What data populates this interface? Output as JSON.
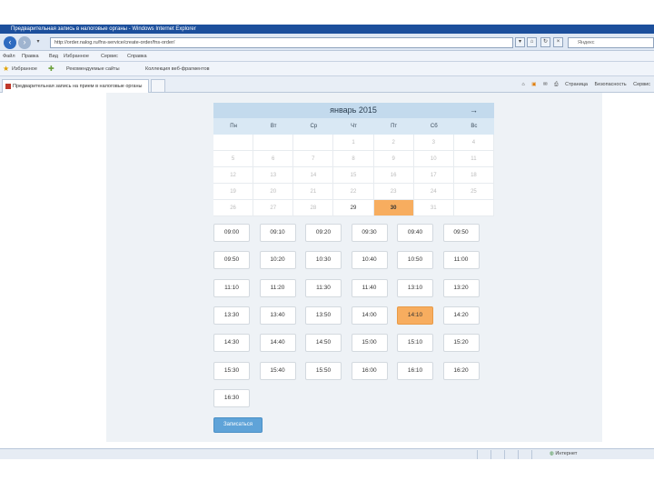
{
  "window": {
    "title": "Предварительная запись в налоговые органы - Windows Internet Explorer"
  },
  "browser": {
    "address": "http://order.nalog.ru/fns-service/create-order/fns-order/",
    "search_placeholder": "Яндекс",
    "menu": [
      "Файл",
      "Правка",
      "Вид",
      "Избранное",
      "Сервис",
      "Справка"
    ],
    "favorites_label": "Избранное",
    "favorites": [
      "Рекомендуемые сайты",
      "Коллекция веб-фрагментов"
    ],
    "tab_title": "Предварительная запись на прием в налоговые органы",
    "commands": [
      "Страница",
      "Безопасность",
      "Сервис"
    ],
    "status_zone": "Интернет"
  },
  "calendar": {
    "month_title": "январь 2015",
    "next_label": "→",
    "weekdays": [
      "Пн",
      "Вт",
      "Ср",
      "Чт",
      "Пт",
      "Сб",
      "Вс"
    ],
    "weeks": [
      [
        "",
        "",
        "",
        "1",
        "2",
        "3",
        "4"
      ],
      [
        "5",
        "6",
        "7",
        "8",
        "9",
        "10",
        "11"
      ],
      [
        "12",
        "13",
        "14",
        "15",
        "16",
        "17",
        "18"
      ],
      [
        "19",
        "20",
        "21",
        "22",
        "23",
        "24",
        "25"
      ],
      [
        "26",
        "27",
        "28",
        "29",
        "30",
        "31",
        ""
      ]
    ],
    "available_days": [
      "29"
    ],
    "selected_day": "30"
  },
  "time_slots": {
    "rows": [
      [
        "09:00",
        "09:10",
        "09:20",
        "09:30",
        "09:40",
        "09:50"
      ],
      [
        "09:50",
        "10:20",
        "10:30",
        "10:40",
        "10:50",
        "11:00"
      ],
      [
        "11:10",
        "11:20",
        "11:30",
        "11:40",
        "13:10",
        "13:20"
      ],
      [
        "13:30",
        "13:40",
        "13:50",
        "14:00",
        "14:10",
        "14:20"
      ],
      [
        "14:30",
        "14:40",
        "14:50",
        "15:00",
        "15:10",
        "15:20"
      ],
      [
        "15:30",
        "15:40",
        "15:50",
        "16:00",
        "16:10",
        "16:20"
      ],
      [
        "16:30"
      ]
    ],
    "selected": "14:10"
  },
  "submit_label": "Записаться",
  "colors": {
    "accent_selected": "#f7ad5f",
    "header_blue": "#c3daed",
    "button_blue": "#5fa3d8"
  }
}
